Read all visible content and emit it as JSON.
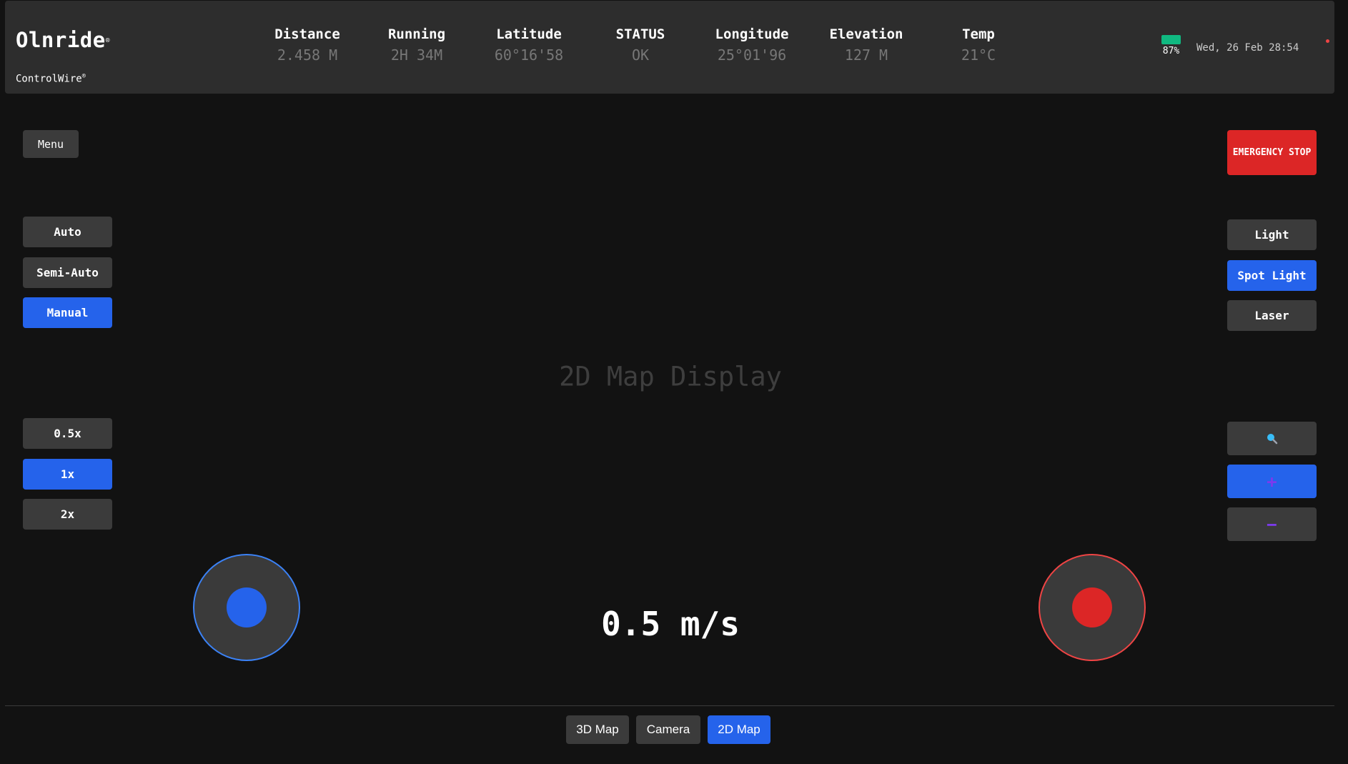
{
  "header": {
    "brand": "Olnride",
    "brand_mark": "®",
    "subbrand": "ControlWire",
    "subbrand_mark": "®",
    "stats": [
      {
        "label": "Distance",
        "value": "2.458 M"
      },
      {
        "label": "Running",
        "value": "2H 34M"
      },
      {
        "label": "Latitude",
        "value": "60°16'58"
      },
      {
        "label": "STATUS",
        "value": "OK"
      },
      {
        "label": "Longitude",
        "value": "25°01'96"
      },
      {
        "label": "Elevation",
        "value": "127 M"
      },
      {
        "label": "Temp",
        "value": "21°C"
      }
    ],
    "battery": "87%",
    "battery_level": 0.87,
    "datetime": "Wed, 26 Feb 28:54"
  },
  "menu_label": "Menu",
  "emergency_label": "EMERGENCY STOP",
  "modes": [
    {
      "label": "Auto",
      "active": false
    },
    {
      "label": "Semi-Auto",
      "active": false
    },
    {
      "label": "Manual",
      "active": true
    }
  ],
  "speeds": [
    {
      "label": "0.5x",
      "active": false
    },
    {
      "label": "1x",
      "active": true
    },
    {
      "label": "2x",
      "active": false
    }
  ],
  "lights": [
    {
      "label": "Light",
      "active": false
    },
    {
      "label": "Spot Light",
      "active": true
    },
    {
      "label": "Laser",
      "active": false
    }
  ],
  "zoom": {
    "search_icon": "magnifier-icon",
    "plus": "+",
    "minus": "−"
  },
  "map_placeholder": "2D Map Display",
  "speed_readout": "0.5 m/s",
  "views": [
    {
      "label": "3D Map",
      "active": false
    },
    {
      "label": "Camera",
      "active": false
    },
    {
      "label": "2D Map",
      "active": true
    }
  ],
  "colors": {
    "accent": "#2563eb",
    "danger": "#dc2626",
    "battery": "#10b981",
    "zoom_sign": "#7c3aed"
  }
}
